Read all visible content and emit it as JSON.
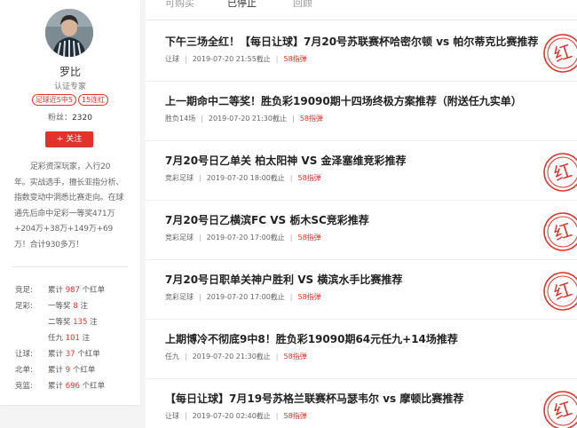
{
  "expert": {
    "name": "罗比",
    "certification": "认证专家",
    "tags": [
      "足球近5中5",
      "15连红"
    ],
    "fans_label": "粉丝：",
    "fans_count": "2320",
    "follow_label": "+ 关注",
    "bio": "足彩资深玩家，入行20年。实战选手，擅长亚指分析、指数变动中洞悉比赛走向。在球通先后命中足彩一等奖471万+204万+38万+149万+69万！合计930多万！"
  },
  "stats": [
    {
      "category": "竞足:",
      "prefix": "累计",
      "value": "987",
      "suffix": "个红单"
    },
    {
      "category": "足彩:",
      "prefix": "一等奖",
      "value": "8",
      "suffix": "注"
    },
    {
      "category": "",
      "prefix": "二等奖",
      "value": "135",
      "suffix": "注"
    },
    {
      "category": "",
      "prefix": "任九",
      "value": "101",
      "suffix": "注"
    },
    {
      "category": "让球:",
      "prefix": "累计",
      "value": "37",
      "suffix": "个红单"
    },
    {
      "category": "北单:",
      "prefix": "累计",
      "value": "9",
      "suffix": "个红单"
    },
    {
      "category": "竞篮:",
      "prefix": "累计",
      "value": "696",
      "suffix": "个红单"
    }
  ],
  "tabs": [
    "可购买",
    "已停止",
    "回顾"
  ],
  "active_tab": 1,
  "items": [
    {
      "title": "下午三场全红！【每日让球】7月20号苏联赛杯哈密尔顿 vs 帕尔蒂克比赛推荐",
      "type": "让球",
      "deadline": "2019-07-20 21:55截止",
      "price": "58指弹",
      "stamp": true
    },
    {
      "title": "上一期命中二等奖！胜负彩19090期十四场终极方案推荐（附送任九实单）",
      "type": "胜负14场",
      "deadline": "2019-07-20 21:30截止",
      "price": "58指弹",
      "stamp": false
    },
    {
      "title": "7月20号日乙单关 柏太阳神 VS 金泽塞维竞彩推荐",
      "type": "竞彩足球",
      "deadline": "2019-07-20 18:00截止",
      "price": "58指弹",
      "stamp": true
    },
    {
      "title": "7月20号日乙横滨FC VS 栃木SC竞彩推荐",
      "type": "竞彩足球",
      "deadline": "2019-07-20 17:00截止",
      "price": "58指弹",
      "stamp": true
    },
    {
      "title": "7月20号日职单关神户胜利 VS 横滨水手比赛推荐",
      "type": "竞彩足球",
      "deadline": "2019-07-20 17:00截止",
      "price": "58指弹",
      "stamp": true
    },
    {
      "title": "上期博冷不彻底9中8！胜负彩19090期64元任九+14场推荐",
      "type": "任九",
      "deadline": "2019-07-20 21:30截止",
      "price": "58指弹",
      "stamp": false
    },
    {
      "title": "【每日让球】7月19号苏格兰联赛杯马瑟韦尔 vs 摩顿比赛推荐",
      "type": "让球",
      "deadline": "2019-07-20 02:40截止",
      "price": "58指弹",
      "stamp": true
    }
  ],
  "stamp_text": "红",
  "colors": {
    "accent": "#e2322b"
  }
}
